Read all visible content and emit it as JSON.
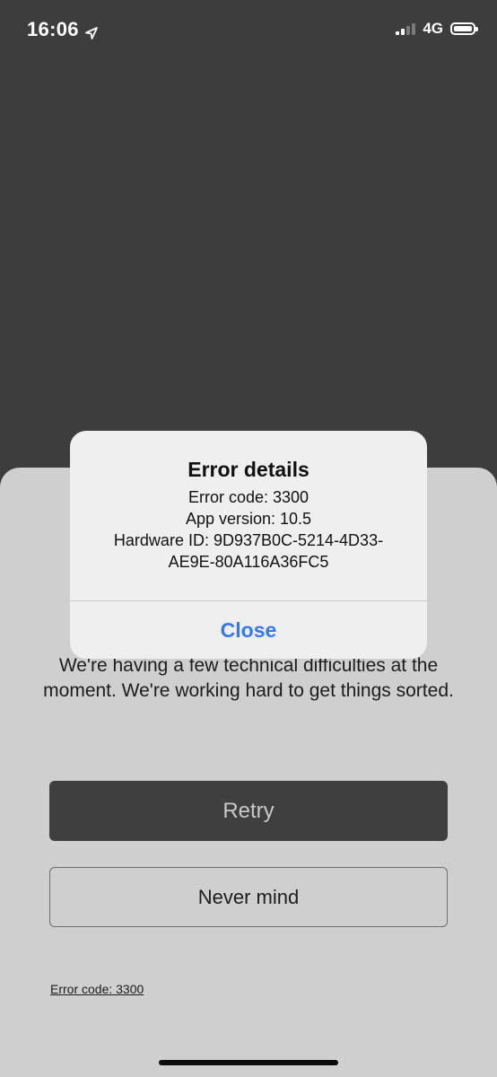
{
  "status_bar": {
    "time": "16:06",
    "network": "4G",
    "icons": [
      "location-arrow-icon",
      "signal-icon",
      "battery-icon"
    ]
  },
  "sheet": {
    "message": "We're having a few technical difficulties at the moment. We're working hard to get things sorted.",
    "retry_label": "Retry",
    "nevermind_label": "Never mind",
    "error_link": "Error code: 3300"
  },
  "alert": {
    "title": "Error details",
    "lines": [
      "Error code: 3300",
      "App version: 10.5",
      "Hardware ID: 9D937B0C-5214-4D33-",
      "AE9E-80A116A36FC5"
    ],
    "close_label": "Close"
  },
  "colors": {
    "background": "#3d3d3d",
    "sheet": "#cfcfcf",
    "alert": "#efefef",
    "accent": "#3478f6",
    "retry_button": "#3f3f3f"
  }
}
